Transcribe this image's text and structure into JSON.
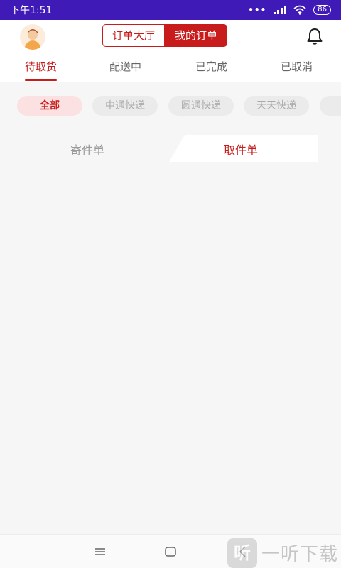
{
  "status_bar": {
    "time": "下午1:51",
    "battery": "86",
    "icons": [
      "dots-icon",
      "signal-icon",
      "wifi-icon",
      "battery-icon"
    ]
  },
  "header": {
    "segment_left": "订单大厅",
    "segment_right": "我的订单",
    "active_segment": "我的订单",
    "icons": [
      "avatar-icon",
      "bell-icon"
    ]
  },
  "tabs": [
    {
      "label": "待取货",
      "active": true
    },
    {
      "label": "配送中",
      "active": false
    },
    {
      "label": "已完成",
      "active": false
    },
    {
      "label": "已取消",
      "active": false
    }
  ],
  "chips": [
    {
      "label": "全部",
      "active": true
    },
    {
      "label": "中通快递",
      "active": false
    },
    {
      "label": "圆通快递",
      "active": false
    },
    {
      "label": "天天快递",
      "active": false
    }
  ],
  "order_type": {
    "left": "寄件单",
    "right": "取件单",
    "active": "取件单"
  },
  "navbar": {
    "icons": [
      "menu-icon",
      "home-icon",
      "back-icon"
    ]
  },
  "watermark": {
    "text": "一听下载"
  },
  "colors": {
    "status_bar": "#3f1ab6",
    "accent": "#c81c1c",
    "background": "#f6f6f6"
  }
}
